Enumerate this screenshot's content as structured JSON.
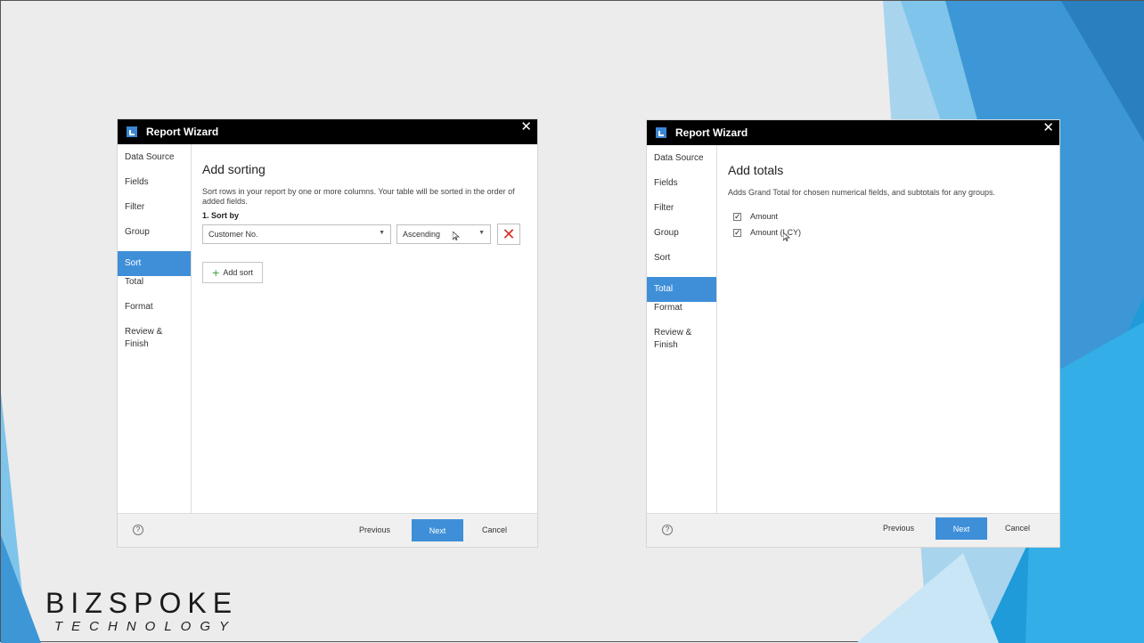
{
  "brand": {
    "logo_main": "BIZSPOKE",
    "logo_sub": "TECHNOLOGY"
  },
  "wizard_left": {
    "title": "Report Wizard",
    "close": "✕",
    "steps": [
      "Data Source",
      "Fields",
      "Filter",
      "Group",
      "Sort",
      "Total",
      "Format",
      "Review & Finish"
    ],
    "active_step": "Sort",
    "heading": "Add sorting",
    "description": "Sort rows in your report by one or more columns. Your table will be sorted in the order of added fields.",
    "sort_label": "1. Sort by",
    "field_value": "Customer No.",
    "order_value": "Ascending",
    "add_sort": "Add sort",
    "footer": {
      "help": "?",
      "previous": "Previous",
      "next": "Next",
      "cancel": "Cancel"
    }
  },
  "wizard_right": {
    "title": "Report Wizard",
    "close": "✕",
    "steps": [
      "Data Source",
      "Fields",
      "Filter",
      "Group",
      "Sort",
      "Total",
      "Format",
      "Review & Finish"
    ],
    "active_step": "Total",
    "heading": "Add totals",
    "description": "Adds Grand Total for chosen numerical fields, and subtotals for any groups.",
    "checkboxes": [
      {
        "label": "Amount",
        "checked": true
      },
      {
        "label": "Amount (LCY)",
        "checked": true
      }
    ],
    "footer": {
      "help": "?",
      "previous": "Previous",
      "next": "Next",
      "cancel": "Cancel"
    }
  },
  "colors": {
    "accent": "#3f8fd8",
    "title_bar": "#000000",
    "remove_red": "#d9302c",
    "add_green": "#4aa14a"
  }
}
